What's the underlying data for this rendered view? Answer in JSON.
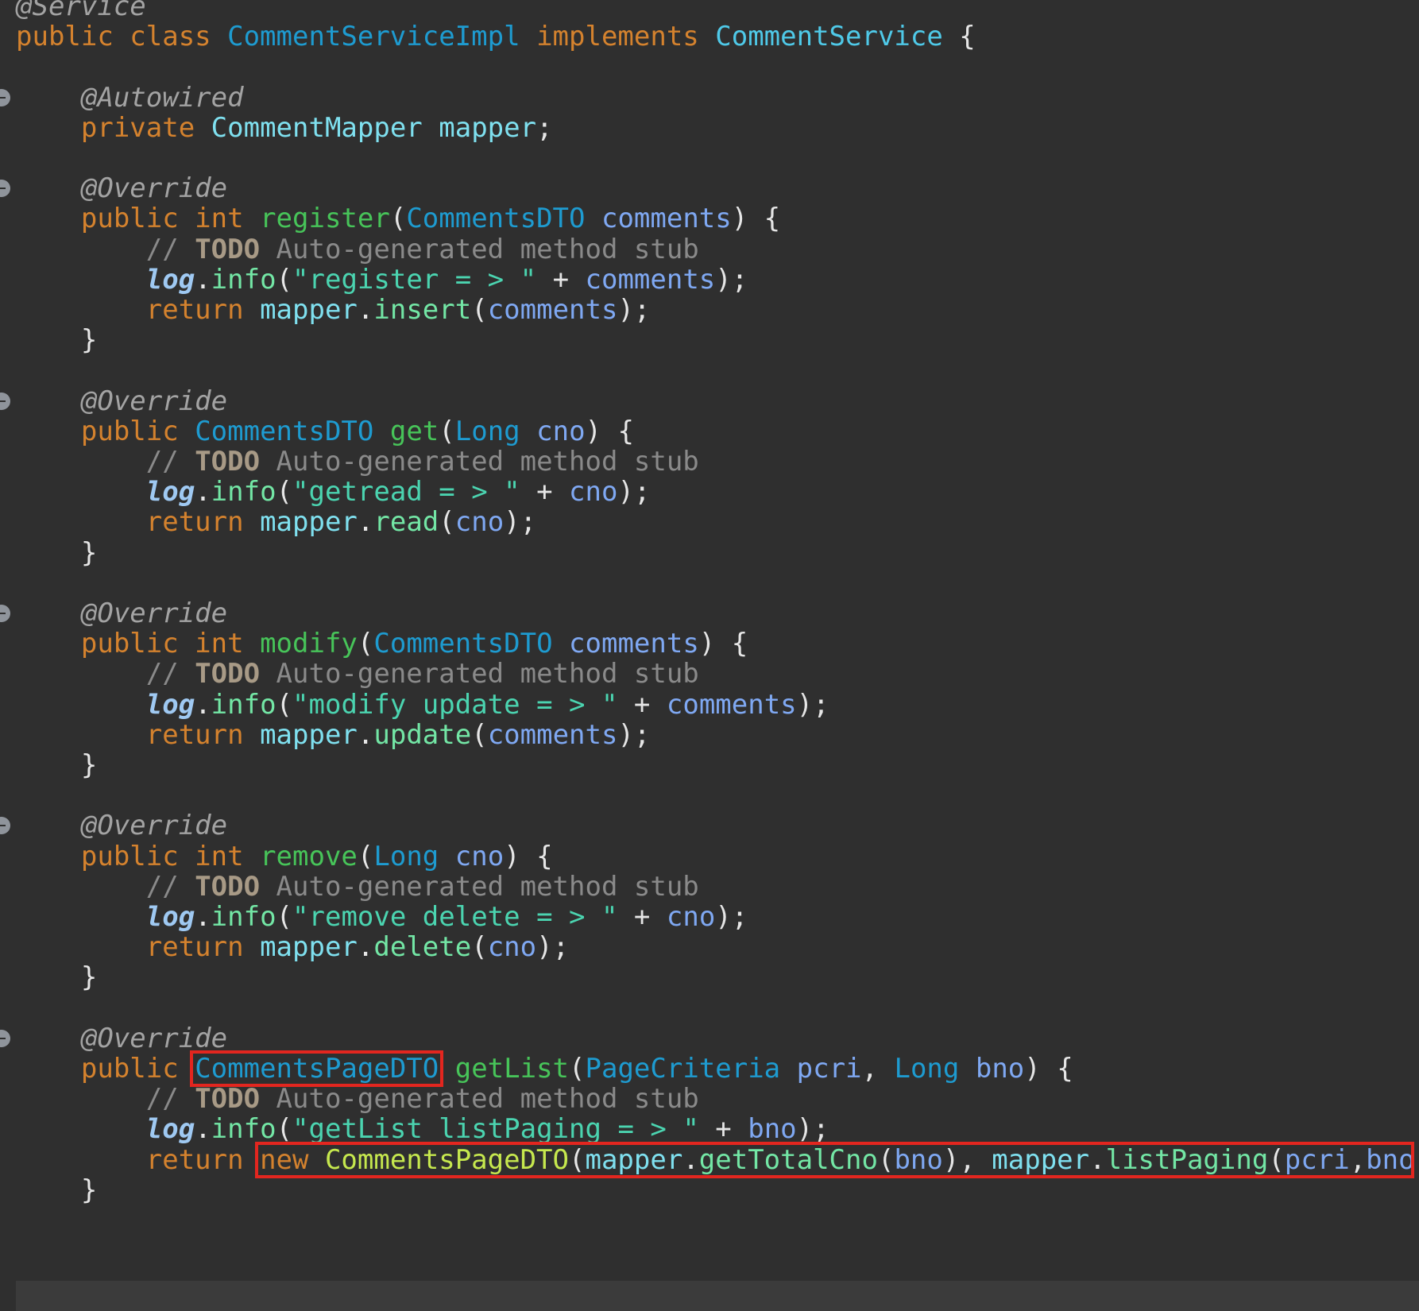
{
  "palette": {
    "background": "#2f2f2f",
    "default": "#e6e6e6",
    "keyword": "#d4822e",
    "type": "#1e9bd0",
    "class_declared": "#4fc9e8",
    "method": "#47c459",
    "call": "#73e6a5",
    "field": "#7fe0ef",
    "param": "#7fa8f2",
    "string": "#4bd4b0",
    "comment": "#8a8a8a",
    "todo": "#a89a86",
    "annotation": "#a3a3a3",
    "static_field": "#9fc9f2",
    "constructor": "#c6e84e",
    "highlight_box": "#e3261f"
  },
  "code": {
    "lines": [
      [
        {
          "t": "@Service",
          "c": "annotation",
          "s": "italic"
        }
      ],
      [
        {
          "t": "public class ",
          "c": "keyword"
        },
        {
          "t": "CommentServiceImpl",
          "c": "type"
        },
        {
          "t": " "
        },
        {
          "t": "implements",
          "c": "keyword"
        },
        {
          "t": " "
        },
        {
          "t": "CommentService",
          "c": "class_declared"
        },
        {
          "t": " {"
        }
      ],
      [],
      [
        {
          "t": "    "
        },
        {
          "t": "@Autowired",
          "c": "annotation",
          "s": "italic"
        }
      ],
      [
        {
          "t": "    "
        },
        {
          "t": "private ",
          "c": "keyword"
        },
        {
          "t": "CommentMapper",
          "c": "field"
        },
        {
          "t": " "
        },
        {
          "t": "mapper",
          "c": "field"
        },
        {
          "t": ";"
        }
      ],
      [],
      [
        {
          "t": "    "
        },
        {
          "t": "@Override",
          "c": "annotation",
          "s": "italic"
        }
      ],
      [
        {
          "t": "    "
        },
        {
          "t": "public int ",
          "c": "keyword"
        },
        {
          "t": "register",
          "c": "method"
        },
        {
          "t": "("
        },
        {
          "t": "CommentsDTO",
          "c": "type"
        },
        {
          "t": " "
        },
        {
          "t": "comments",
          "c": "param"
        },
        {
          "t": ") {"
        }
      ],
      [
        {
          "t": "        "
        },
        {
          "t": "// ",
          "c": "comment"
        },
        {
          "t": "TODO",
          "c": "todo",
          "s": "bold"
        },
        {
          "t": " Auto-generated method stub",
          "c": "comment"
        }
      ],
      [
        {
          "t": "        "
        },
        {
          "t": "log",
          "c": "static_field",
          "s": "bold-italic"
        },
        {
          "t": "."
        },
        {
          "t": "info",
          "c": "call"
        },
        {
          "t": "("
        },
        {
          "t": "\"register = > \"",
          "c": "string"
        },
        {
          "t": " + "
        },
        {
          "t": "comments",
          "c": "param"
        },
        {
          "t": ");"
        }
      ],
      [
        {
          "t": "        "
        },
        {
          "t": "return ",
          "c": "keyword"
        },
        {
          "t": "mapper",
          "c": "field"
        },
        {
          "t": "."
        },
        {
          "t": "insert",
          "c": "call"
        },
        {
          "t": "("
        },
        {
          "t": "comments",
          "c": "param"
        },
        {
          "t": ");"
        }
      ],
      [
        {
          "t": "    }"
        }
      ],
      [],
      [
        {
          "t": "    "
        },
        {
          "t": "@Override",
          "c": "annotation",
          "s": "italic"
        }
      ],
      [
        {
          "t": "    "
        },
        {
          "t": "public ",
          "c": "keyword"
        },
        {
          "t": "CommentsDTO",
          "c": "type"
        },
        {
          "t": " "
        },
        {
          "t": "get",
          "c": "method"
        },
        {
          "t": "("
        },
        {
          "t": "Long",
          "c": "type"
        },
        {
          "t": " "
        },
        {
          "t": "cno",
          "c": "param"
        },
        {
          "t": ") {"
        }
      ],
      [
        {
          "t": "        "
        },
        {
          "t": "// ",
          "c": "comment"
        },
        {
          "t": "TODO",
          "c": "todo",
          "s": "bold"
        },
        {
          "t": " Auto-generated method stub",
          "c": "comment"
        }
      ],
      [
        {
          "t": "        "
        },
        {
          "t": "log",
          "c": "static_field",
          "s": "bold-italic"
        },
        {
          "t": "."
        },
        {
          "t": "info",
          "c": "call"
        },
        {
          "t": "("
        },
        {
          "t": "\"getread = > \"",
          "c": "string"
        },
        {
          "t": " + "
        },
        {
          "t": "cno",
          "c": "param"
        },
        {
          "t": ");"
        }
      ],
      [
        {
          "t": "        "
        },
        {
          "t": "return ",
          "c": "keyword"
        },
        {
          "t": "mapper",
          "c": "field"
        },
        {
          "t": "."
        },
        {
          "t": "read",
          "c": "call"
        },
        {
          "t": "("
        },
        {
          "t": "cno",
          "c": "param"
        },
        {
          "t": ");"
        }
      ],
      [
        {
          "t": "    }"
        }
      ],
      [],
      [
        {
          "t": "    "
        },
        {
          "t": "@Override",
          "c": "annotation",
          "s": "italic"
        }
      ],
      [
        {
          "t": "    "
        },
        {
          "t": "public int ",
          "c": "keyword"
        },
        {
          "t": "modify",
          "c": "method"
        },
        {
          "t": "("
        },
        {
          "t": "CommentsDTO",
          "c": "type"
        },
        {
          "t": " "
        },
        {
          "t": "comments",
          "c": "param"
        },
        {
          "t": ") {"
        }
      ],
      [
        {
          "t": "        "
        },
        {
          "t": "// ",
          "c": "comment"
        },
        {
          "t": "TODO",
          "c": "todo",
          "s": "bold"
        },
        {
          "t": " Auto-generated method stub",
          "c": "comment"
        }
      ],
      [
        {
          "t": "        "
        },
        {
          "t": "log",
          "c": "static_field",
          "s": "bold-italic"
        },
        {
          "t": "."
        },
        {
          "t": "info",
          "c": "call"
        },
        {
          "t": "("
        },
        {
          "t": "\"modify update = > \"",
          "c": "string"
        },
        {
          "t": " + "
        },
        {
          "t": "comments",
          "c": "param"
        },
        {
          "t": ");"
        }
      ],
      [
        {
          "t": "        "
        },
        {
          "t": "return ",
          "c": "keyword"
        },
        {
          "t": "mapper",
          "c": "field"
        },
        {
          "t": "."
        },
        {
          "t": "update",
          "c": "call"
        },
        {
          "t": "("
        },
        {
          "t": "comments",
          "c": "param"
        },
        {
          "t": ");"
        }
      ],
      [
        {
          "t": "    }"
        }
      ],
      [],
      [
        {
          "t": "    "
        },
        {
          "t": "@Override",
          "c": "annotation",
          "s": "italic"
        }
      ],
      [
        {
          "t": "    "
        },
        {
          "t": "public int ",
          "c": "keyword"
        },
        {
          "t": "remove",
          "c": "method"
        },
        {
          "t": "("
        },
        {
          "t": "Long",
          "c": "type"
        },
        {
          "t": " "
        },
        {
          "t": "cno",
          "c": "param"
        },
        {
          "t": ") {"
        }
      ],
      [
        {
          "t": "        "
        },
        {
          "t": "// ",
          "c": "comment"
        },
        {
          "t": "TODO",
          "c": "todo",
          "s": "bold"
        },
        {
          "t": " Auto-generated method stub",
          "c": "comment"
        }
      ],
      [
        {
          "t": "        "
        },
        {
          "t": "log",
          "c": "static_field",
          "s": "bold-italic"
        },
        {
          "t": "."
        },
        {
          "t": "info",
          "c": "call"
        },
        {
          "t": "("
        },
        {
          "t": "\"remove delete = > \"",
          "c": "string"
        },
        {
          "t": " + "
        },
        {
          "t": "cno",
          "c": "param"
        },
        {
          "t": ");"
        }
      ],
      [
        {
          "t": "        "
        },
        {
          "t": "return ",
          "c": "keyword"
        },
        {
          "t": "mapper",
          "c": "field"
        },
        {
          "t": "."
        },
        {
          "t": "delete",
          "c": "call"
        },
        {
          "t": "("
        },
        {
          "t": "cno",
          "c": "param"
        },
        {
          "t": ");"
        }
      ],
      [
        {
          "t": "    }"
        }
      ],
      [],
      [
        {
          "t": "    "
        },
        {
          "t": "@Override",
          "c": "annotation",
          "s": "italic"
        }
      ],
      [
        {
          "t": "    "
        },
        {
          "t": "public ",
          "c": "keyword"
        },
        {
          "t": "CommentsPageDTO",
          "c": "type",
          "box": true
        },
        {
          "t": " "
        },
        {
          "t": "getList",
          "c": "method"
        },
        {
          "t": "("
        },
        {
          "t": "PageCriteria",
          "c": "type"
        },
        {
          "t": " "
        },
        {
          "t": "pcri",
          "c": "param"
        },
        {
          "t": ", "
        },
        {
          "t": "Long",
          "c": "type"
        },
        {
          "t": " "
        },
        {
          "t": "bno",
          "c": "param"
        },
        {
          "t": ") {"
        }
      ],
      [
        {
          "t": "        "
        },
        {
          "t": "// ",
          "c": "comment"
        },
        {
          "t": "TODO",
          "c": "todo",
          "s": "bold"
        },
        {
          "t": " Auto-generated method stub",
          "c": "comment"
        }
      ],
      [
        {
          "t": "        "
        },
        {
          "t": "log",
          "c": "static_field",
          "s": "bold-italic"
        },
        {
          "t": "."
        },
        {
          "t": "info",
          "c": "call"
        },
        {
          "t": "("
        },
        {
          "t": "\"getList listPaging = > \"",
          "c": "string"
        },
        {
          "t": " + "
        },
        {
          "t": "bno",
          "c": "param"
        },
        {
          "t": ");"
        }
      ],
      [
        {
          "t": "        "
        },
        {
          "t": "return ",
          "c": "keyword"
        },
        {
          "t": "new ",
          "c": "keyword",
          "boxstart": true
        },
        {
          "t": "CommentsPageDTO",
          "c": "constructor"
        },
        {
          "t": "("
        },
        {
          "t": "mapper",
          "c": "field"
        },
        {
          "t": "."
        },
        {
          "t": "getTotalCno",
          "c": "call"
        },
        {
          "t": "("
        },
        {
          "t": "bno",
          "c": "param"
        },
        {
          "t": "), "
        },
        {
          "t": "mapper",
          "c": "field"
        },
        {
          "t": "."
        },
        {
          "t": "listPaging",
          "c": "call"
        },
        {
          "t": "("
        },
        {
          "t": "pcri",
          "c": "param"
        },
        {
          "t": ","
        },
        {
          "t": "bno",
          "c": "param"
        },
        {
          "t": "));",
          "boxend": true
        }
      ],
      [
        {
          "t": "    }"
        }
      ]
    ]
  }
}
